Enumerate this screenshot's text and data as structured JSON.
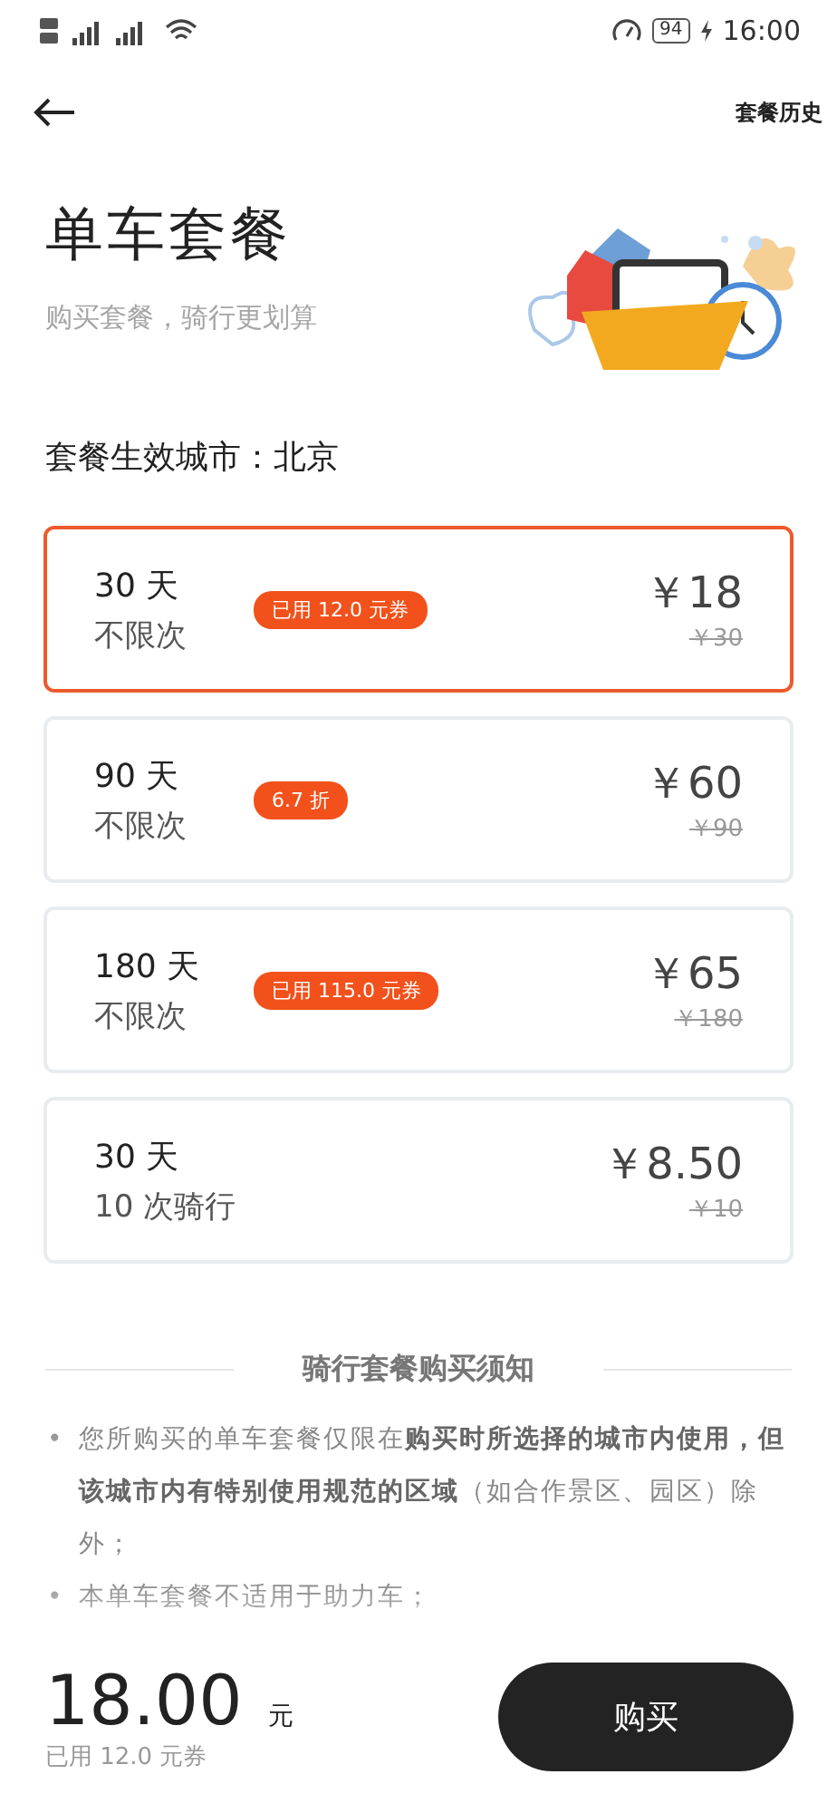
{
  "status_bar": {
    "battery": "94",
    "time": "16:00"
  },
  "nav": {
    "history_link": "套餐历史"
  },
  "header": {
    "title": "单车套餐",
    "subtitle": "购买套餐，骑行更划算"
  },
  "city": "套餐生效城市：北京",
  "plans": [
    {
      "duration": "30 天",
      "usage": "不限次",
      "badge": "已用 12.0 元券",
      "price": "￥18",
      "original_price": "￥30",
      "selected": true
    },
    {
      "duration": "90 天",
      "usage": "不限次",
      "badge": "6.7 折",
      "price": "￥60",
      "original_price": "￥90",
      "selected": false
    },
    {
      "duration": "180 天",
      "usage": "不限次",
      "badge": "已用 115.0 元券",
      "price": "￥65",
      "original_price": "￥180",
      "selected": false
    },
    {
      "duration": "30 天",
      "usage": "10 次骑行",
      "price": "￥8.50",
      "original_price": "￥10",
      "selected": false
    }
  ],
  "notice": {
    "title": "骑行套餐购买须知",
    "items": [
      {
        "bullet": "•",
        "text": "您所购买的单车套餐仅限在**购买时所选择的城市内使用，但该城市内有特别使用规范的区域**（如合作景区、园区）除外；"
      },
      {
        "bullet": "•",
        "text": "本单车套餐不适用于助力车；"
      }
    ]
  },
  "footer": {
    "total": "18.00",
    "unit": "元",
    "coupon_note": "已用 12.0 元券",
    "buy_button": "购买"
  }
}
